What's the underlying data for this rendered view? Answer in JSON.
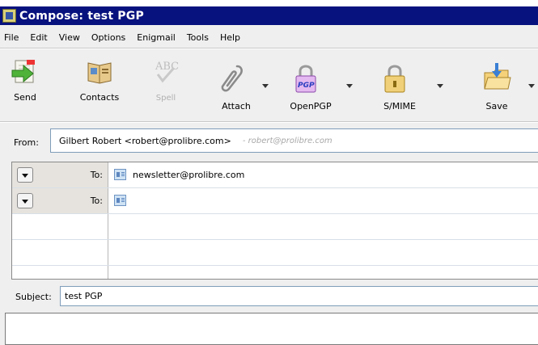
{
  "window": {
    "title": "Compose: test PGP"
  },
  "menu": [
    {
      "label": "File"
    },
    {
      "label": "Edit"
    },
    {
      "label": "View"
    },
    {
      "label": "Options"
    },
    {
      "label": "Enigmail"
    },
    {
      "label": "Tools"
    },
    {
      "label": "Help"
    }
  ],
  "toolbar": {
    "send": "Send",
    "contacts": "Contacts",
    "spell": "Spell",
    "attach": "Attach",
    "openpgp": "OpenPGP",
    "openpgp_badge": "PGP",
    "smime": "S/MIME",
    "save": "Save"
  },
  "from": {
    "label": "From:",
    "value": "Gilbert Robert <robert@prolibre.com>",
    "identity_hint": "- robert@prolibre.com"
  },
  "recipients": [
    {
      "type": "To:",
      "address": "newsletter@prolibre.com"
    },
    {
      "type": "To:",
      "address": ""
    }
  ],
  "subject": {
    "label": "Subject:",
    "value": "test PGP"
  }
}
